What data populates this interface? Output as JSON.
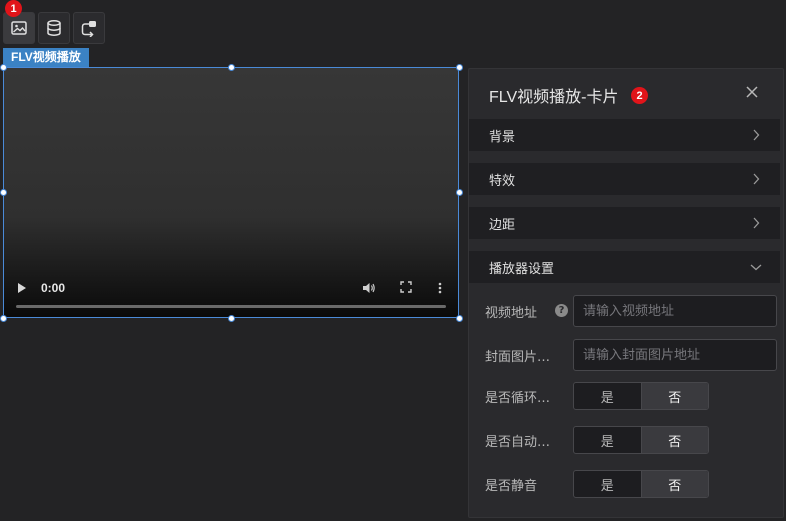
{
  "toolbar": {
    "buttons": [
      {
        "icon": "image-icon",
        "active": true
      },
      {
        "icon": "database-icon",
        "active": false
      },
      {
        "icon": "interaction-icon",
        "active": false
      }
    ],
    "badge": "1"
  },
  "component": {
    "label": "FLV视频播放",
    "video": {
      "time": "0:00"
    }
  },
  "panel": {
    "title": "FLV视频播放-卡片",
    "badge": "2",
    "sections": [
      {
        "label": "背景",
        "expanded": false
      },
      {
        "label": "特效",
        "expanded": false
      },
      {
        "label": "边距",
        "expanded": false
      },
      {
        "label": "播放器设置",
        "expanded": true
      }
    ],
    "fields": {
      "video_url": {
        "label": "视频地址",
        "value": "",
        "placeholder": "请输入视频地址"
      },
      "cover_url": {
        "label": "封面图片…",
        "value": "",
        "placeholder": "请输入封面图片地址"
      },
      "loop": {
        "label": "是否循环…",
        "yes": "是",
        "no": "否",
        "selected": "否"
      },
      "autoplay": {
        "label": "是否自动…",
        "yes": "是",
        "no": "否",
        "selected": "否"
      },
      "muted": {
        "label": "是否静音",
        "yes": "是",
        "no": "否",
        "selected": "否"
      }
    }
  },
  "colors": {
    "accent": "#3b82c4",
    "badge": "#e1141a",
    "panel_bg": "#2a2a2d",
    "page_bg": "#232325"
  }
}
